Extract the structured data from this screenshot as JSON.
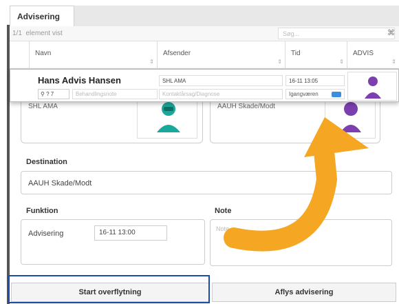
{
  "tab": {
    "label": "Advisering"
  },
  "list": {
    "count_text": "1/1",
    "count_label": "element vist",
    "search_placeholder": "Søg..."
  },
  "columns": [
    {
      "label": "Navn"
    },
    {
      "label": "Afsender"
    },
    {
      "label": "Tid"
    },
    {
      "label": "ADVIS"
    }
  ],
  "row": {
    "name": "Hans Advis Hansen",
    "number": "? 7",
    "note_placeholder": "Behandlingsnote",
    "sender": "SHL AMA",
    "kontakt_placeholder": "Kontaktårsag/Diagnose",
    "time": "16-11 13:05",
    "status": "Igangværen"
  },
  "cards": {
    "left_label": "SHL AMA",
    "right_label": "AAUH Skade/Modt"
  },
  "destination": {
    "label": "Destination",
    "value": "AAUH Skade/Modt"
  },
  "funktion": {
    "label": "Funktion",
    "type": "Advisering",
    "time": "16-11 13:00"
  },
  "note": {
    "label": "Note",
    "placeholder": "Note"
  },
  "buttons": {
    "start": "Start overflytning",
    "cancel": "Aflys advisering"
  },
  "colors": {
    "highlight": "#1c4aa6",
    "arrow": "#f5a623",
    "avatar_teal": "#1aa89a",
    "avatar_purple": "#7b3fb0",
    "toggle": "#3b8ede"
  }
}
